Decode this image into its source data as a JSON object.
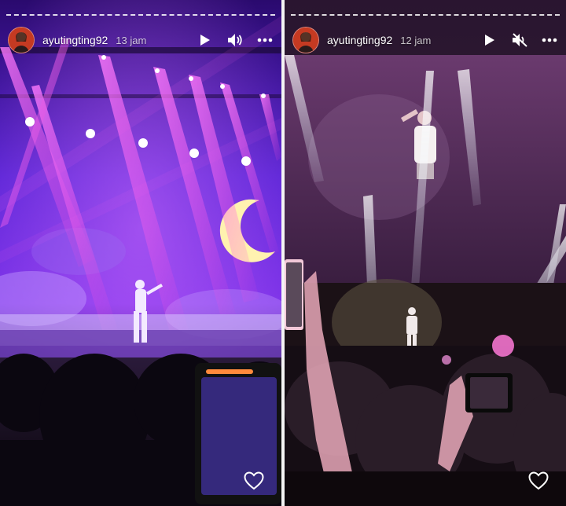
{
  "stories": [
    {
      "username": "ayutingting92",
      "time": "13 jam",
      "icons": {
        "play": "play-icon",
        "sound": "speaker-icon",
        "more": "more-icon",
        "like": "heart-icon"
      },
      "sound": "on",
      "accent": "#b12cff"
    },
    {
      "username": "ayutingting92",
      "time": "12 jam",
      "icons": {
        "play": "play-icon",
        "sound": "speaker-muted-icon",
        "more": "more-icon",
        "like": "heart-icon"
      },
      "sound": "muted",
      "accent": "#8a2a8a"
    }
  ]
}
